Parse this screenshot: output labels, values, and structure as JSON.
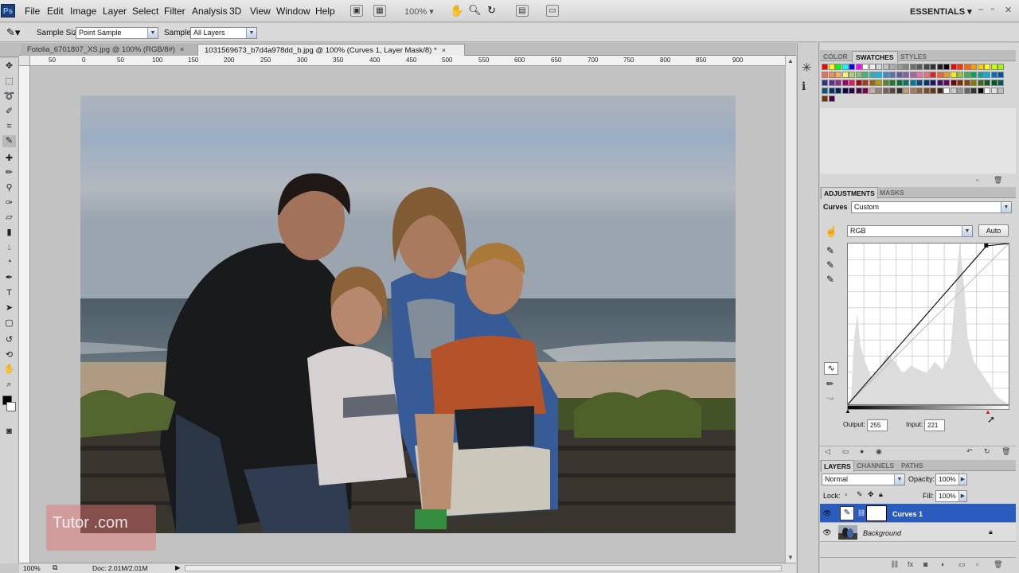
{
  "app": {
    "logo": "Ps"
  },
  "menu": {
    "items": [
      "File",
      "Edit",
      "Image",
      "Layer",
      "Select",
      "Filter",
      "Analysis",
      "3D",
      "View",
      "Window",
      "Help"
    ]
  },
  "appbar": {
    "zoom": "100%",
    "workspace": "ESSENTIALS"
  },
  "options": {
    "sample_size_label": "Sample Size:",
    "sample_size_value": "Point Sample",
    "sample_label": "Sample:",
    "sample_value": "All Layers"
  },
  "tabs": [
    {
      "label": "Fotolia_6701807_XS.jpg @ 100% (RGB/8#)",
      "close": "×"
    },
    {
      "label": "1031569673_b7d4a978dd_b.jpg @ 100% (Curves 1, Layer Mask/8) *",
      "close": "×"
    }
  ],
  "ruler": {
    "labels": [
      "50",
      "0",
      "50",
      "100",
      "150",
      "200",
      "250",
      "300",
      "350",
      "400",
      "450",
      "500",
      "550",
      "600",
      "650",
      "700",
      "750",
      "800",
      "850",
      "900"
    ]
  },
  "status": {
    "zoom": "100%",
    "doc": "Doc: 2.01M/2.01M"
  },
  "watermark": {
    "text": "Tutor   .com"
  },
  "swatches_panel": {
    "tabs": [
      "COLOR",
      "SWATCHES",
      "STYLES"
    ],
    "active": "SWATCHES"
  },
  "adjustments": {
    "tabs": [
      "ADJUSTMENTS",
      "MASKS"
    ],
    "title": "Curves",
    "preset": "Custom",
    "channel": "RGB",
    "auto_label": "Auto",
    "output_label": "Output:",
    "output_value": "255",
    "input_label": "Input:",
    "input_value": "221"
  },
  "layers": {
    "tabs": [
      "LAYERS",
      "CHANNELS",
      "PATHS"
    ],
    "blend_mode": "Normal",
    "opacity_label": "Opacity:",
    "opacity_value": "100%",
    "lock_label": "Lock:",
    "fill_label": "Fill:",
    "fill_value": "100%",
    "rows": [
      {
        "name": "Curves 1",
        "selected": true
      },
      {
        "name": "Background",
        "selected": false
      }
    ]
  },
  "colors": {
    "selection": "#2a5bbf",
    "accent": "#1d3f7a"
  }
}
